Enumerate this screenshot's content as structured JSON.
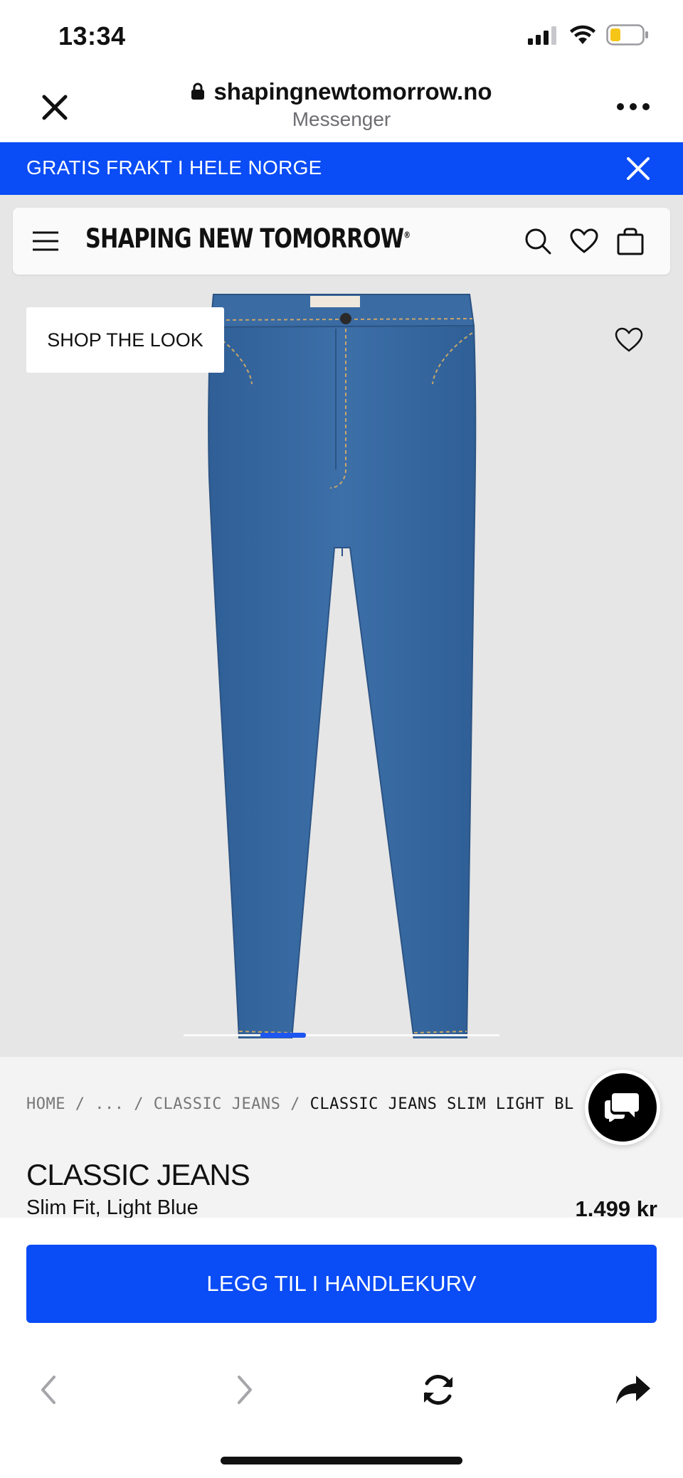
{
  "status_bar": {
    "time": "13:34",
    "icons": [
      "signal-icon",
      "wifi-icon",
      "battery-icon"
    ]
  },
  "browser": {
    "url": "shapingnewtomorrow.no",
    "subtitle": "Messenger",
    "icons": [
      "close-icon",
      "lock-icon",
      "more-icon"
    ]
  },
  "promo": {
    "text": "GRATIS FRAKT I HELE NORGE",
    "color": "#0a4cf5"
  },
  "site_header": {
    "logo": "SHAPING NEW TOMORROW",
    "logo_mark": "®",
    "icons": [
      "menu-icon",
      "search-icon",
      "heart-icon",
      "bag-icon"
    ]
  },
  "product_image": {
    "shop_the_look": "SHOP THE LOOK",
    "slide_index": 1
  },
  "breadcrumb": {
    "home": "HOME",
    "sep1": " / ",
    "ellipsis": "...",
    "sep2": " / ",
    "category": "CLASSIC JEANS",
    "sep3": " / ",
    "current": "CLASSIC JEANS SLIM LIGHT BL"
  },
  "product": {
    "title": "CLASSIC JEANS",
    "subtitle": "Slim Fit, Light Blue",
    "price": "1.499 kr"
  },
  "cta": {
    "label": "LEGG TIL I HANDLEKURV",
    "color": "#0a4cf5"
  },
  "browser_nav": {
    "icons": [
      "back-icon",
      "forward-icon",
      "reload-icon",
      "share-icon"
    ]
  }
}
